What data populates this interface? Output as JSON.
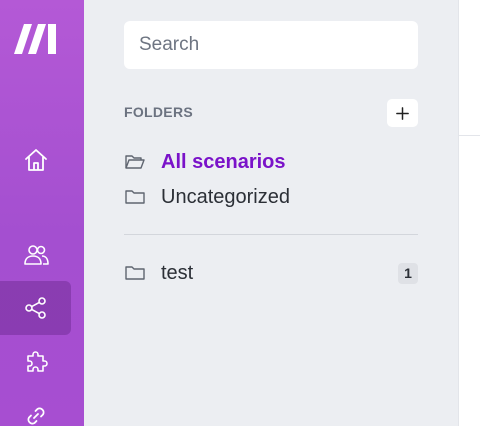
{
  "brand": {
    "accent": "#a855d6",
    "active_folder_color": "#7a12c9"
  },
  "sidebar": {
    "logo_icon": "make-logo",
    "items": [
      {
        "icon": "home-icon",
        "label": "Home"
      },
      {
        "icon": "users-icon",
        "label": "Team"
      },
      {
        "icon": "share-icon",
        "label": "Scenarios",
        "active": true
      },
      {
        "icon": "puzzle-icon",
        "label": "Apps"
      },
      {
        "icon": "link-icon",
        "label": "Connections"
      }
    ]
  },
  "search": {
    "placeholder": "Search",
    "value": ""
  },
  "folders": {
    "heading": "FOLDERS",
    "add_label": "+",
    "items": [
      {
        "label": "All scenarios",
        "icon": "folder-open-icon",
        "active": true
      },
      {
        "label": "Uncategorized",
        "icon": "folder-icon"
      }
    ],
    "custom": [
      {
        "label": "test",
        "icon": "folder-icon",
        "count": "1"
      }
    ]
  }
}
